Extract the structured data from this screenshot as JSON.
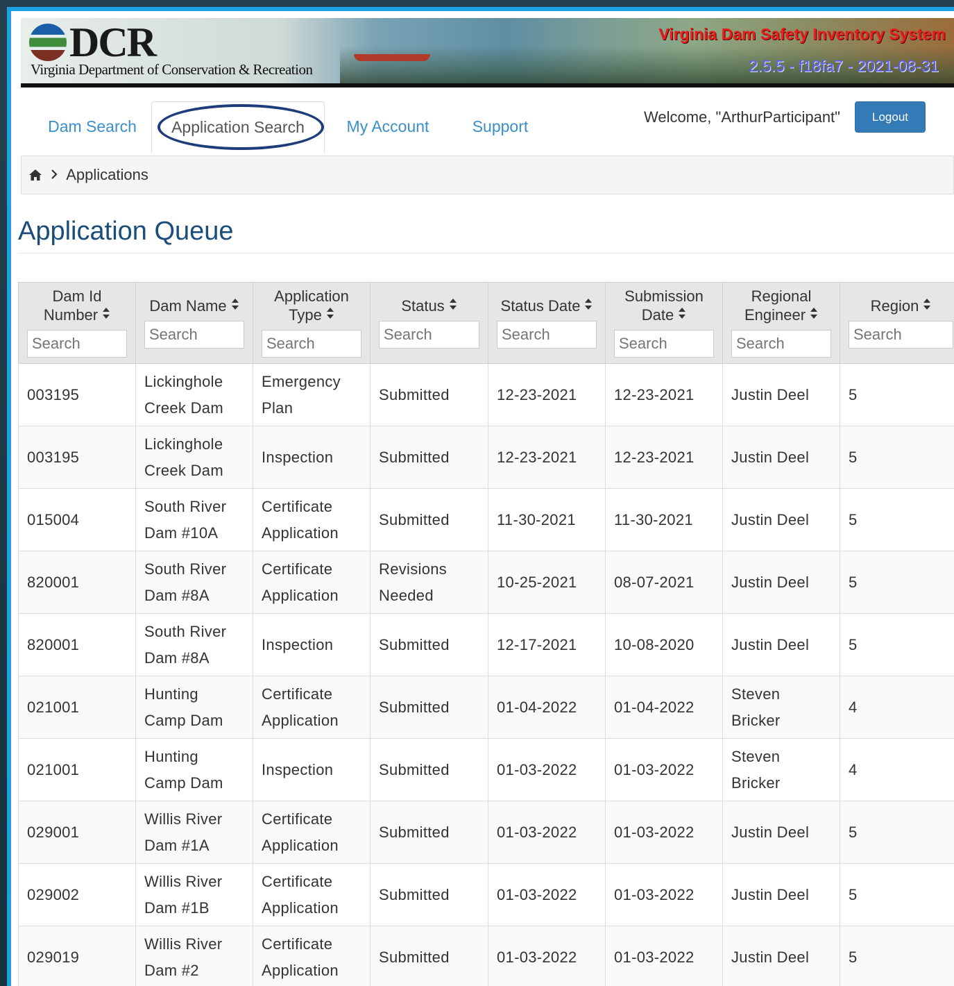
{
  "banner": {
    "logo_text": "DCR",
    "logo_subtitle": "Virginia Department of Conservation & Recreation",
    "system_title": "Virginia Dam Safety Inventory System",
    "version": "2.5.5 - f18fa7 - 2021-08-31"
  },
  "nav": {
    "tabs": [
      {
        "label": "Dam Search"
      },
      {
        "label": "Application Search"
      },
      {
        "label": "My Account"
      },
      {
        "label": "Support"
      }
    ],
    "welcome": "Welcome, \"ArthurParticipant\"",
    "logout_label": "Logout"
  },
  "breadcrumb": {
    "current": "Applications"
  },
  "page_title": "Application Queue",
  "table": {
    "columns": [
      {
        "label": "Dam Id Number",
        "placeholder": "Search"
      },
      {
        "label": "Dam Name",
        "placeholder": "Search"
      },
      {
        "label": "Application Type",
        "placeholder": "Search"
      },
      {
        "label": "Status",
        "placeholder": "Search"
      },
      {
        "label": "Status Date",
        "placeholder": "Search"
      },
      {
        "label": "Submission Date",
        "placeholder": "Search"
      },
      {
        "label": "Regional Engineer",
        "placeholder": "Search"
      },
      {
        "label": "Region",
        "placeholder": "Search"
      }
    ],
    "rows": [
      {
        "dam_id": "003195",
        "dam_name": "Lickinghole Creek Dam",
        "app_type": "Emergency Plan",
        "status": "Submitted",
        "status_date": "12-23-2021",
        "submission_date": "12-23-2021",
        "engineer": "Justin Deel",
        "region": "5"
      },
      {
        "dam_id": "003195",
        "dam_name": "Lickinghole Creek Dam",
        "app_type": "Inspection",
        "status": "Submitted",
        "status_date": "12-23-2021",
        "submission_date": "12-23-2021",
        "engineer": "Justin Deel",
        "region": "5"
      },
      {
        "dam_id": "015004",
        "dam_name": "South River Dam #10A",
        "app_type": "Certificate Application",
        "status": "Submitted",
        "status_date": "11-30-2021",
        "submission_date": "11-30-2021",
        "engineer": "Justin Deel",
        "region": "5"
      },
      {
        "dam_id": "820001",
        "dam_name": "South River Dam #8A",
        "app_type": "Certificate Application",
        "status": "Revisions Needed",
        "status_date": "10-25-2021",
        "submission_date": "08-07-2021",
        "engineer": "Justin Deel",
        "region": "5"
      },
      {
        "dam_id": "820001",
        "dam_name": "South River Dam #8A",
        "app_type": "Inspection",
        "status": "Submitted",
        "status_date": "12-17-2021",
        "submission_date": "10-08-2020",
        "engineer": "Justin Deel",
        "region": "5"
      },
      {
        "dam_id": "021001",
        "dam_name": "Hunting Camp Dam",
        "app_type": "Certificate Application",
        "status": "Submitted",
        "status_date": "01-04-2022",
        "submission_date": "01-04-2022",
        "engineer": "Steven Bricker",
        "region": "4"
      },
      {
        "dam_id": "021001",
        "dam_name": "Hunting Camp Dam",
        "app_type": "Inspection",
        "status": "Submitted",
        "status_date": "01-03-2022",
        "submission_date": "01-03-2022",
        "engineer": "Steven Bricker",
        "region": "4"
      },
      {
        "dam_id": "029001",
        "dam_name": "Willis River Dam #1A",
        "app_type": "Certificate Application",
        "status": "Submitted",
        "status_date": "01-03-2022",
        "submission_date": "01-03-2022",
        "engineer": "Justin Deel",
        "region": "5"
      },
      {
        "dam_id": "029002",
        "dam_name": "Willis River Dam #1B",
        "app_type": "Certificate Application",
        "status": "Submitted",
        "status_date": "01-03-2022",
        "submission_date": "01-03-2022",
        "engineer": "Justin Deel",
        "region": "5"
      },
      {
        "dam_id": "029019",
        "dam_name": "Willis River Dam #2",
        "app_type": "Certificate Application",
        "status": "Submitted",
        "status_date": "01-03-2022",
        "submission_date": "01-03-2022",
        "engineer": "Justin Deel",
        "region": "5"
      }
    ]
  },
  "colors": {
    "accent": "#1da1e0",
    "link": "#3a8fc8",
    "button": "#337ab7",
    "title": "#1a4d7a",
    "system_title": "#e8201a"
  },
  "icons": {
    "home": "home-icon",
    "breadcrumb_separator": "chevron-right-icon",
    "sort": "sort-icon"
  }
}
